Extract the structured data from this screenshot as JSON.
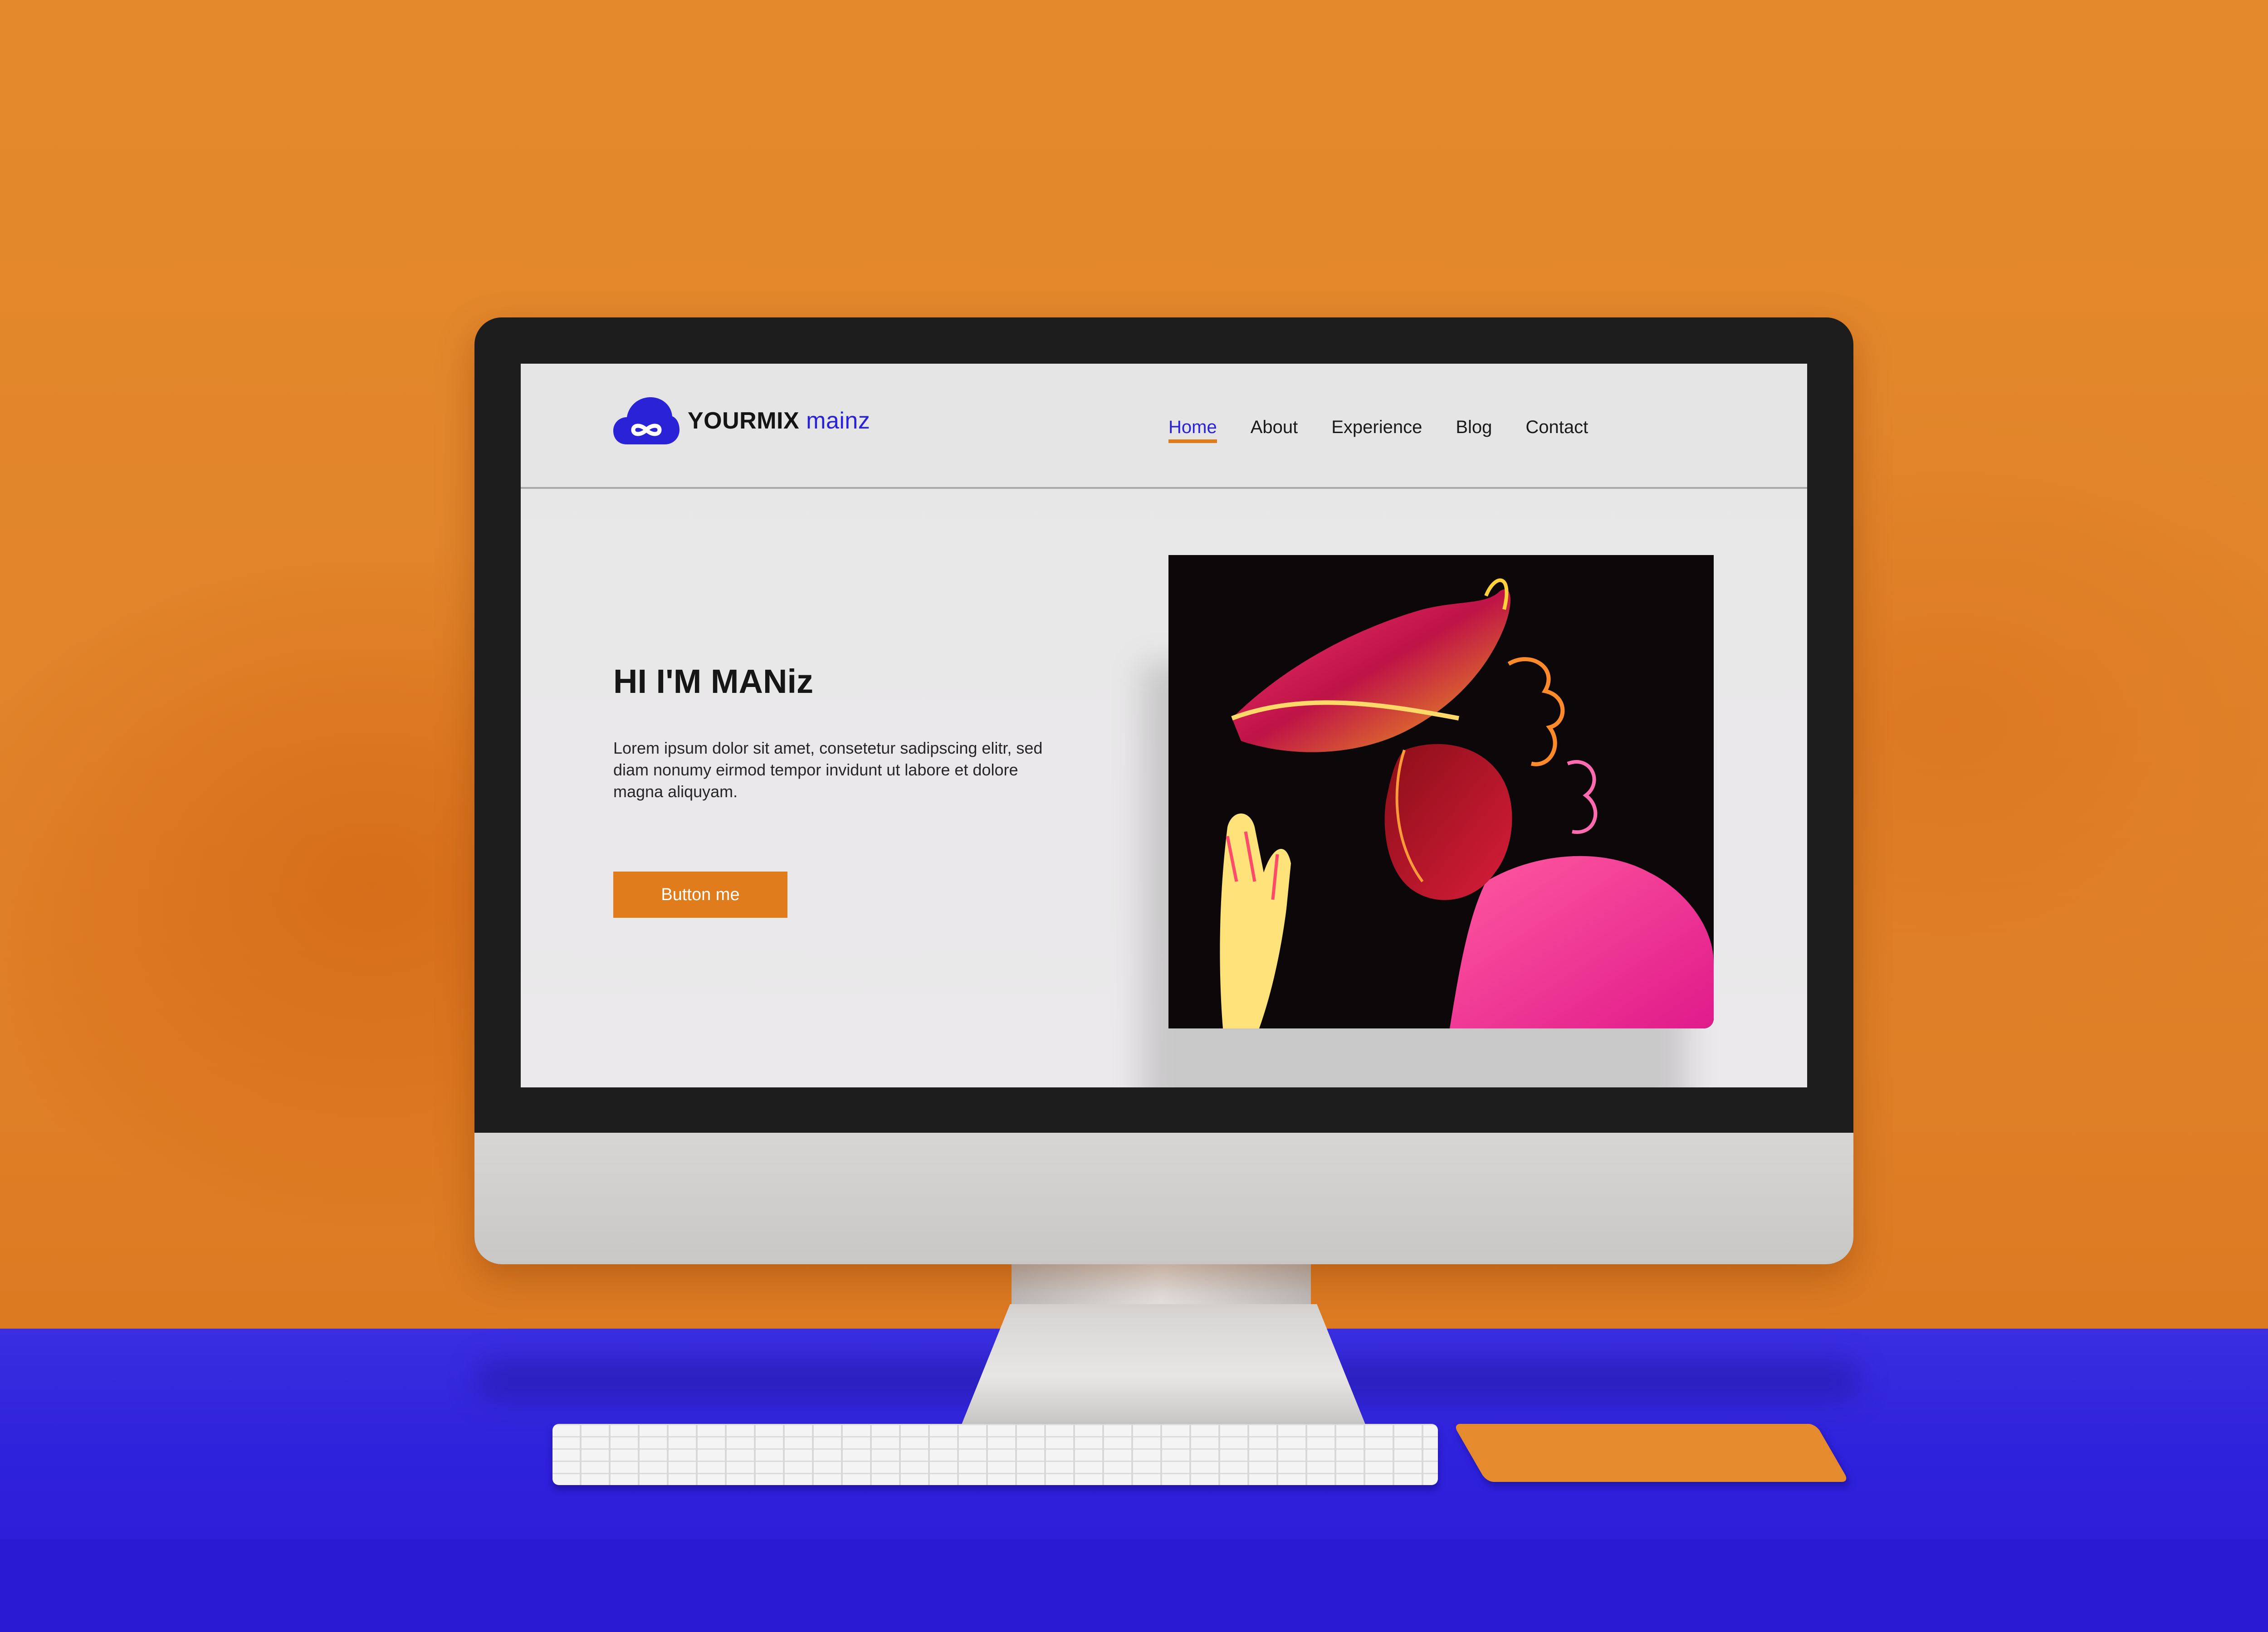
{
  "site": {
    "logo": {
      "brand": "YOURMIX",
      "brand_accent": "mainz",
      "icon": "cloud-infinity-icon"
    },
    "nav": {
      "items": [
        {
          "label": "Home",
          "active": true
        },
        {
          "label": "About",
          "active": false
        },
        {
          "label": "Experience",
          "active": false
        },
        {
          "label": "Blog",
          "active": false
        },
        {
          "label": "Contact",
          "active": false
        }
      ]
    },
    "hero": {
      "title": "HI I'M MANiz",
      "description": "Lorem ipsum dolor sit amet, consetetur sadipscing elitr, sed diam nonumy eirmod tempor invidunt ut labore et dolore magna aliquyam.",
      "button_label": "Button me"
    }
  },
  "colors": {
    "wall": "#e2832a",
    "desk": "#2f22dc",
    "accent_orange": "#e07c1c",
    "accent_blue": "#2a22d6"
  }
}
